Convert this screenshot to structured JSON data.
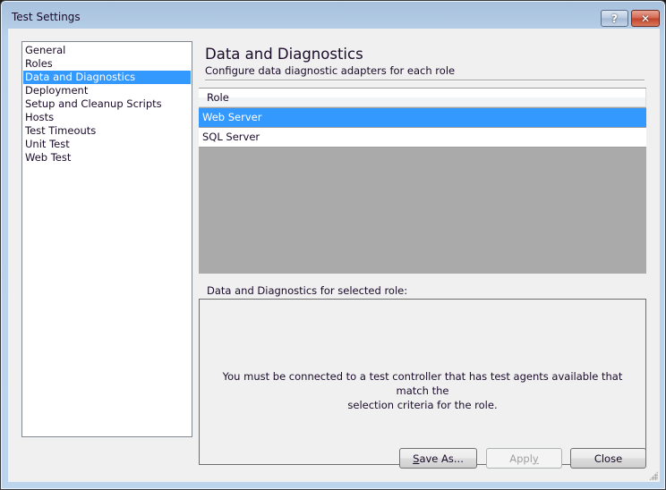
{
  "window": {
    "title": "Test Settings",
    "help_label": "?",
    "close_label": "✕"
  },
  "nav": {
    "items": [
      {
        "label": "General",
        "selected": false
      },
      {
        "label": "Roles",
        "selected": false
      },
      {
        "label": "Data and Diagnostics",
        "selected": true
      },
      {
        "label": "Deployment",
        "selected": false
      },
      {
        "label": "Setup and Cleanup Scripts",
        "selected": false
      },
      {
        "label": "Hosts",
        "selected": false
      },
      {
        "label": "Test Timeouts",
        "selected": false
      },
      {
        "label": "Unit Test",
        "selected": false
      },
      {
        "label": "Web Test",
        "selected": false
      }
    ]
  },
  "page": {
    "title": "Data and Diagnostics",
    "subtitle": "Configure data diagnostic adapters for each role"
  },
  "roles_grid": {
    "header": "Role",
    "rows": [
      {
        "label": "Web Server",
        "selected": true
      },
      {
        "label": "SQL Server",
        "selected": false
      }
    ]
  },
  "details": {
    "label": "Data and Diagnostics for selected role:",
    "message_line1": "You must be connected to a test controller that has test agents available that match the",
    "message_line2": "selection criteria for the role."
  },
  "buttons": {
    "save_as_mnemonic": "S",
    "save_as_rest": "ave As...",
    "apply_main": "Appl",
    "apply_mnemonic": "y",
    "apply_enabled": false,
    "close": "Close"
  },
  "colors": {
    "selection": "#3399ff",
    "grid_empty": "#aaaaaa",
    "client_bg": "#f0f0f0"
  }
}
